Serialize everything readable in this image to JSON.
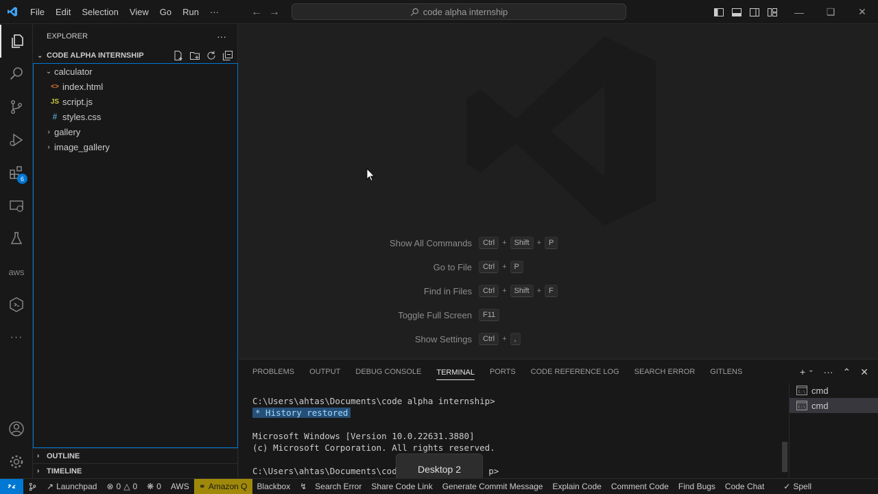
{
  "titlebar": {
    "menu": [
      "File",
      "Edit",
      "Selection",
      "View",
      "Go",
      "Run",
      "···"
    ],
    "search_text": "code alpha internship"
  },
  "activity": {
    "extensions_badge": "6",
    "aws_label": "aws"
  },
  "sidebar": {
    "title": "EXPLORER",
    "more": "···",
    "root": "CODE ALPHA INTERNSHIP",
    "tree": [
      {
        "label": "calculator",
        "type": "folder",
        "expanded": true,
        "depth": 0
      },
      {
        "label": "index.html",
        "type": "html",
        "depth": 1,
        "icon": "<>"
      },
      {
        "label": "script.js",
        "type": "js",
        "depth": 1,
        "icon": "JS"
      },
      {
        "label": "styles.css",
        "type": "css",
        "depth": 1,
        "icon": "#"
      },
      {
        "label": "gallery",
        "type": "folder",
        "expanded": false,
        "depth": 0
      },
      {
        "label": "image_gallery",
        "type": "folder",
        "expanded": false,
        "depth": 0
      }
    ],
    "outline": "OUTLINE",
    "timeline": "TIMELINE"
  },
  "editor": {
    "shortcuts": [
      {
        "label": "Show All Commands",
        "keys": [
          "Ctrl",
          "Shift",
          "P"
        ]
      },
      {
        "label": "Go to File",
        "keys": [
          "Ctrl",
          "P"
        ]
      },
      {
        "label": "Find in Files",
        "keys": [
          "Ctrl",
          "Shift",
          "F"
        ]
      },
      {
        "label": "Toggle Full Screen",
        "keys": [
          "F11"
        ]
      },
      {
        "label": "Show Settings",
        "keys": [
          "Ctrl",
          ","
        ]
      }
    ]
  },
  "panel": {
    "tabs": [
      "PROBLEMS",
      "OUTPUT",
      "DEBUG CONSOLE",
      "TERMINAL",
      "PORTS",
      "CODE REFERENCE LOG",
      "SEARCH ERROR",
      "GITLENS"
    ],
    "active_tab": "TERMINAL",
    "terminal": {
      "prompt1": "C:\\Users\\ahtas\\Documents\\code alpha internship>",
      "history": " *  History restored ",
      "line_win": "Microsoft Windows [Version 10.0.22631.3880]",
      "line_copy": "(c) Microsoft Corporation. All rights reserved.",
      "prompt2_a": "C:\\Users\\ahtas\\Documents\\code",
      "prompt2_b": "p>"
    },
    "terminals": [
      "cmd",
      "cmd"
    ]
  },
  "desktop_tip": "Desktop 2",
  "statusbar": {
    "errors": "0",
    "warnings": "0",
    "ports": "0",
    "items": [
      "Launchpad",
      "AWS",
      "Amazon Q",
      "Blackbox",
      "Search Error",
      "Share Code Link",
      "Generate Commit Message",
      "Explain Code",
      "Comment Code",
      "Find Bugs",
      "Code Chat",
      "Spell"
    ]
  },
  "colors": {
    "accent": "#0078d4",
    "html_icon": "#e37933",
    "js_icon": "#cbcb41",
    "css_icon": "#519aba"
  }
}
